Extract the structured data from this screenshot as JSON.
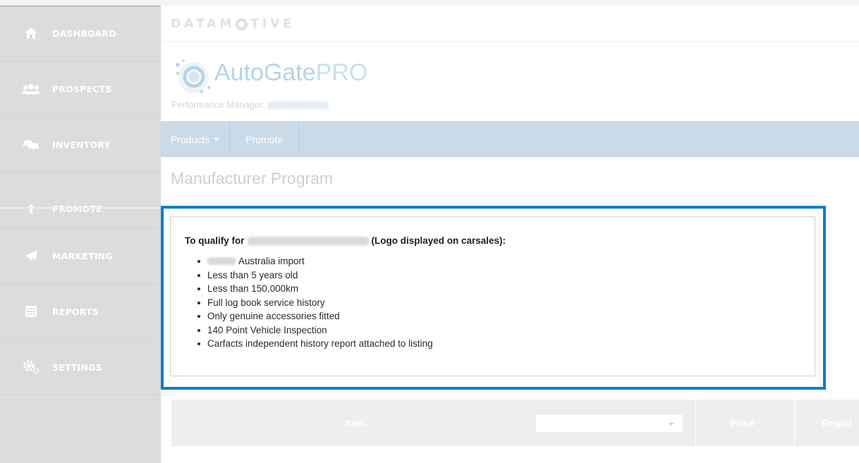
{
  "sidebar": {
    "items": [
      {
        "label": "DASHBOARD",
        "icon": "home-icon"
      },
      {
        "label": "PROSPECTS",
        "icon": "users-icon"
      },
      {
        "label": "INVENTORY",
        "icon": "cars-icon"
      },
      {
        "label": "PROMOTE",
        "icon": "arrow-up-icon"
      },
      {
        "label": "MARKETING",
        "icon": "paper-plane-icon"
      },
      {
        "label": "REPORTS",
        "icon": "report-grid-icon"
      },
      {
        "label": "SETTINGS",
        "icon": "gears-icon"
      }
    ]
  },
  "header": {
    "brand_left": "DATAM",
    "brand_right": "TIVE",
    "app_name_main": "AutoGate",
    "app_name_suffix": "PRO",
    "performance_label": "Performance Manager:"
  },
  "menu": {
    "products": "Products",
    "promote": "Promote"
  },
  "page": {
    "title": "Manufacturer Program"
  },
  "qualify": {
    "prefix": "To qualify for",
    "suffix": "(Logo displayed on carsales):",
    "items": [
      "Australia import",
      "Less than 5 years old",
      "Less than 150,000km",
      "Full log book service history",
      "Only genuine accessories fitted",
      "140 Point Vehicle Inspection",
      "Carfacts independent history report attached to listing"
    ]
  },
  "table": {
    "columns": [
      "Item",
      "Price",
      "Regist"
    ]
  },
  "colors": {
    "highlight": "#0a7fc9",
    "menubar": "#c9dbe9",
    "sidebar": "#dcdcdc"
  }
}
